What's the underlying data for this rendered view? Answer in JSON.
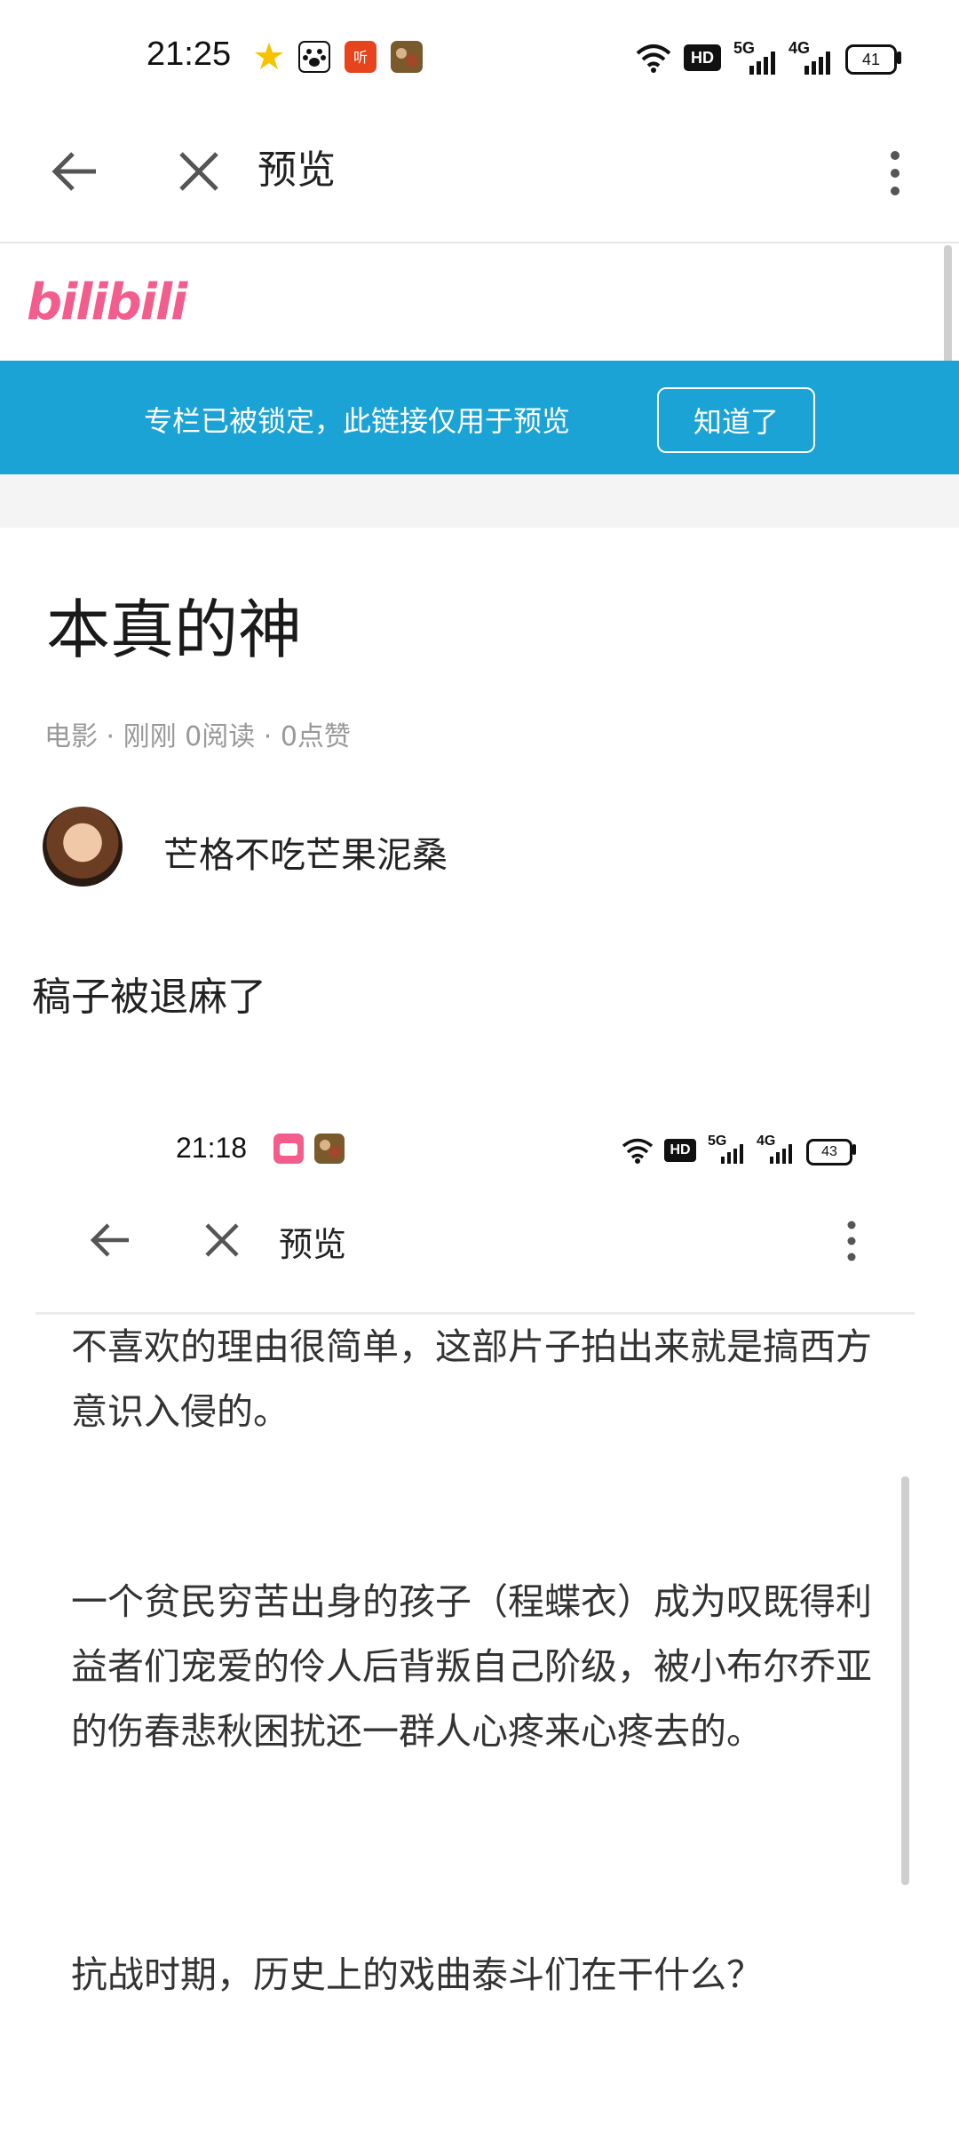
{
  "status_bar": {
    "time": "21:25",
    "icons": [
      "star-icon",
      "paw-app-icon",
      "listen-app-icon",
      "game-avatar-icon"
    ],
    "network_hd": "HD",
    "network_5g": "5G",
    "network_4g": "4G",
    "battery": "41"
  },
  "toolbar": {
    "title": "预览",
    "icons": [
      "back-arrow-icon",
      "close-icon",
      "more-vert-icon"
    ]
  },
  "brand": {
    "logo_text": "bilibili",
    "color": "#f25d8e"
  },
  "banner": {
    "text": "专栏已被锁定，此链接仅用于预览",
    "button": "知道了",
    "color": "#1ba3d6"
  },
  "article": {
    "title": "本真的神",
    "meta": "电影 · 刚刚 0阅读 · 0点赞",
    "author": "芒格不吃芒果泥桑",
    "first_line": "稿子被退麻了"
  },
  "embedded_screenshot": {
    "status_bar": {
      "time": "21:18",
      "battery": "43",
      "network_hd": "HD",
      "network_5g": "5G",
      "network_4g": "4G"
    },
    "toolbar": {
      "title": "预览"
    },
    "paragraphs": [
      "不喜欢的理由很简单，这部片子拍出来就是搞西方意识入侵的。",
      "一个贫民穷苦出身的孩子（程蝶衣）成为叹既得利益者们宠爱的伶人后背叛自己阶级，被小布尔乔亚的伤春悲秋困扰还一群人心疼来心疼去的。",
      "抗战时期，历史上的戏曲泰斗们在干什么？"
    ]
  }
}
